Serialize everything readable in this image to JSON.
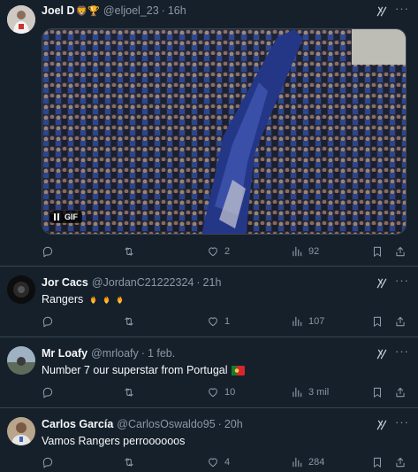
{
  "tweets": [
    {
      "name": "Joel D",
      "handle": "@eljoel_23",
      "time": "16h",
      "text": "",
      "media_badge": "GIF",
      "replies": "",
      "retweets": "",
      "likes": "2",
      "views": "92"
    },
    {
      "name": "Jor Cacs",
      "handle": "@JordanC21222324",
      "time": "21h",
      "text": "Rangers",
      "replies": "",
      "retweets": "",
      "likes": "1",
      "views": "107"
    },
    {
      "name": "Mr Loafy",
      "handle": "@mrloafy",
      "time": "1 feb.",
      "text": "Number 7 our superstar from Portugal",
      "replies": "",
      "retweets": "",
      "likes": "10",
      "views": "3 mil"
    },
    {
      "name": "Carlos García",
      "handle": "@CarlosOswaldo95",
      "time": "20h",
      "text": "Vamos Rangers perroooooos",
      "replies": "",
      "retweets": "",
      "likes": "4",
      "views": "284"
    }
  ],
  "separator": "·",
  "icons": {
    "reply": "reply-icon",
    "retweet": "retweet-icon",
    "like": "heart-icon",
    "views": "views-icon",
    "bookmark": "bookmark-icon",
    "share": "share-icon",
    "grok": "grok-icon",
    "fire": "fire-emoji",
    "flag": "portugal-flag-emoji"
  },
  "colors": {
    "background": "#15202b",
    "border": "#38444d",
    "text": "#f7f9f9",
    "muted": "#8b98a5"
  }
}
